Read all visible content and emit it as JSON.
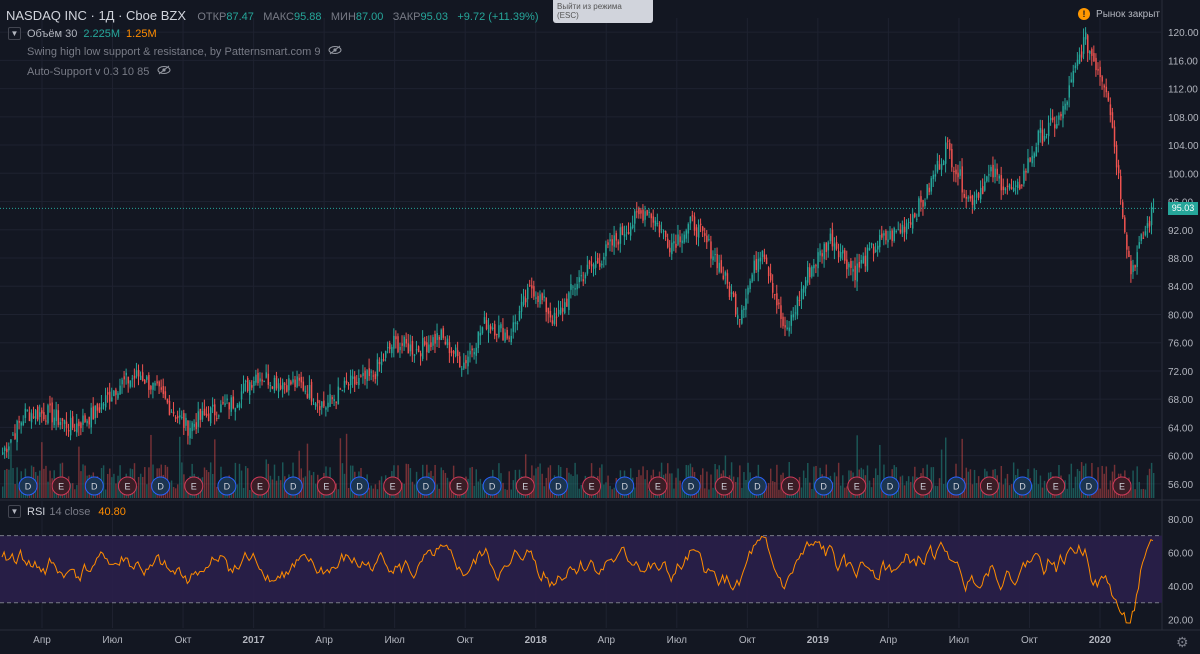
{
  "header": {
    "symbol": "NASDAQ INC · 1Д · Cboe BZX",
    "open_label": "ОТКР",
    "open_value": "87.47",
    "high_label": "МАКС",
    "high_value": "95.88",
    "low_label": "МИН",
    "low_value": "87.00",
    "close_label": "ЗАКР",
    "close_value": "95.03",
    "change": "+9.72 (+11.39%)"
  },
  "exit_tooltip": {
    "line1": "Выйти из режима",
    "line2": "(ESC)"
  },
  "market_status": {
    "icon": "!",
    "label": "Рынок закрыт"
  },
  "indicators": {
    "volume": {
      "name": "Объём 30",
      "v1": "2.225M",
      "v2": "1.25M"
    },
    "swing": {
      "name": "Swing high low support & resistance, by Patternsmart.com 9"
    },
    "auto_support": {
      "name": "Auto-Support v 0.3 10 85"
    }
  },
  "price_axis": [
    "120.00",
    "116.00",
    "112.00",
    "108.00",
    "104.00",
    "100.00",
    "96.00",
    "92.00",
    "88.00",
    "84.00",
    "80.00",
    "76.00",
    "72.00",
    "68.00",
    "64.00",
    "60.00",
    "56.00"
  ],
  "last_price": "95.03",
  "rsi": {
    "name": "RSI",
    "params": "14 close",
    "value": "40.80",
    "axis": [
      "80.00",
      "60.00",
      "40.00",
      "20.00"
    ]
  },
  "time_axis": [
    "Апр",
    "Июл",
    "Окт",
    "2017",
    "Апр",
    "Июл",
    "Окт",
    "2018",
    "Апр",
    "Июл",
    "Окт",
    "2019",
    "Апр",
    "Июл",
    "Окт",
    "2020"
  ],
  "events": [
    "D",
    "E",
    "D",
    "E",
    "D",
    "E",
    "D",
    "E",
    "D",
    "E",
    "D",
    "E",
    "D",
    "E",
    "D",
    "E",
    "D",
    "E",
    "D",
    "E",
    "D",
    "E",
    "D",
    "E",
    "D",
    "E",
    "D",
    "E",
    "D",
    "E",
    "D",
    "E",
    "D",
    "E"
  ],
  "colors": {
    "up": "#26a69a",
    "down": "#ef5350",
    "rsi_line": "#ff8c00",
    "rsi_band": "#2a1f4a",
    "bg": "#131722",
    "grid": "#1e2230"
  },
  "chart_data": {
    "type": "candlestick",
    "ylim": [
      54,
      122
    ],
    "x_range": [
      "2016-02",
      "2020-03"
    ],
    "anchors": [
      [
        "2016-02",
        60.5
      ],
      [
        "2016-03",
        66
      ],
      [
        "2016-04",
        66
      ],
      [
        "2016-05",
        64
      ],
      [
        "2016-06",
        66
      ],
      [
        "2016-07",
        70
      ],
      [
        "2016-08",
        71.5
      ],
      [
        "2016-09",
        68
      ],
      [
        "2016-10",
        64
      ],
      [
        "2016-11",
        66
      ],
      [
        "2016-12",
        67.5
      ],
      [
        "2017-01",
        71.5
      ],
      [
        "2017-02",
        70.5
      ],
      [
        "2017-03",
        70
      ],
      [
        "2017-04",
        67
      ],
      [
        "2017-05",
        70
      ],
      [
        "2017-06",
        71
      ],
      [
        "2017-07",
        76
      ],
      [
        "2017-08",
        75
      ],
      [
        "2017-09",
        77
      ],
      [
        "2017-10",
        73
      ],
      [
        "2017-11",
        79
      ],
      [
        "2017-12",
        77
      ],
      [
        "2018-01",
        84
      ],
      [
        "2018-02",
        79
      ],
      [
        "2018-03",
        85
      ],
      [
        "2018-04",
        88
      ],
      [
        "2018-05",
        92
      ],
      [
        "2018-06",
        95
      ],
      [
        "2018-07",
        90
      ],
      [
        "2018-08",
        93
      ],
      [
        "2018-09",
        88
      ],
      [
        "2018-10",
        80
      ],
      [
        "2018-11",
        90
      ],
      [
        "2018-12",
        77
      ],
      [
        "2019-01",
        86
      ],
      [
        "2019-02",
        91
      ],
      [
        "2019-03",
        86
      ],
      [
        "2019-04",
        90
      ],
      [
        "2019-05",
        92
      ],
      [
        "2019-06",
        96
      ],
      [
        "2019-07",
        104
      ],
      [
        "2019-08",
        96
      ],
      [
        "2019-09",
        100
      ],
      [
        "2019-10",
        97
      ],
      [
        "2019-11",
        105
      ],
      [
        "2019-12",
        108
      ],
      [
        "2020-01",
        119
      ],
      [
        "2020-02",
        112
      ],
      [
        "2020-03-a",
        86
      ],
      [
        "2020-03-b",
        95
      ]
    ],
    "rsi_ylim": [
      15,
      90
    ],
    "rsi_levels": [
      70,
      30
    ]
  }
}
